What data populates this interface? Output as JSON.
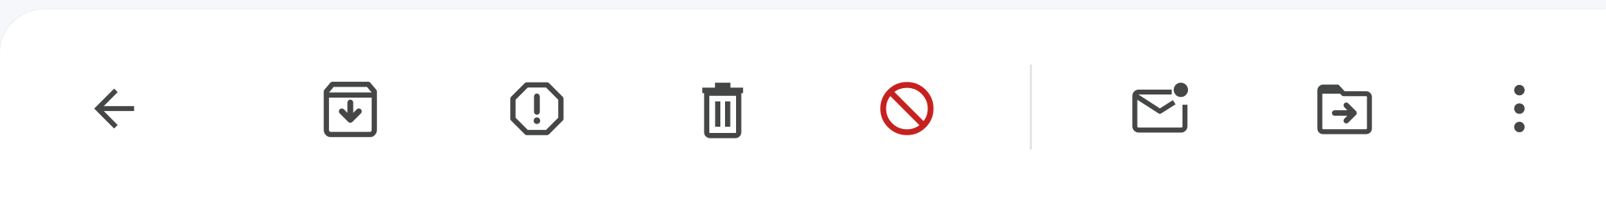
{
  "toolbar": {
    "colors": {
      "icon": "#444746",
      "spam_red": "#c5221f",
      "divider": "#e4e6ea",
      "background": "#ffffff"
    },
    "actions": [
      {
        "icon": "arrow-back-icon",
        "tooltip": ""
      },
      {
        "icon": "archive-icon",
        "tooltip": ""
      },
      {
        "icon": "report-spam-icon",
        "tooltip": ""
      },
      {
        "icon": "delete-icon",
        "tooltip": ""
      },
      {
        "icon": "block-icon",
        "tooltip": ""
      },
      {
        "icon": "mark-unread-icon",
        "tooltip": ""
      },
      {
        "icon": "move-to-icon",
        "tooltip": ""
      },
      {
        "icon": "more-options-icon",
        "tooltip": ""
      }
    ]
  }
}
